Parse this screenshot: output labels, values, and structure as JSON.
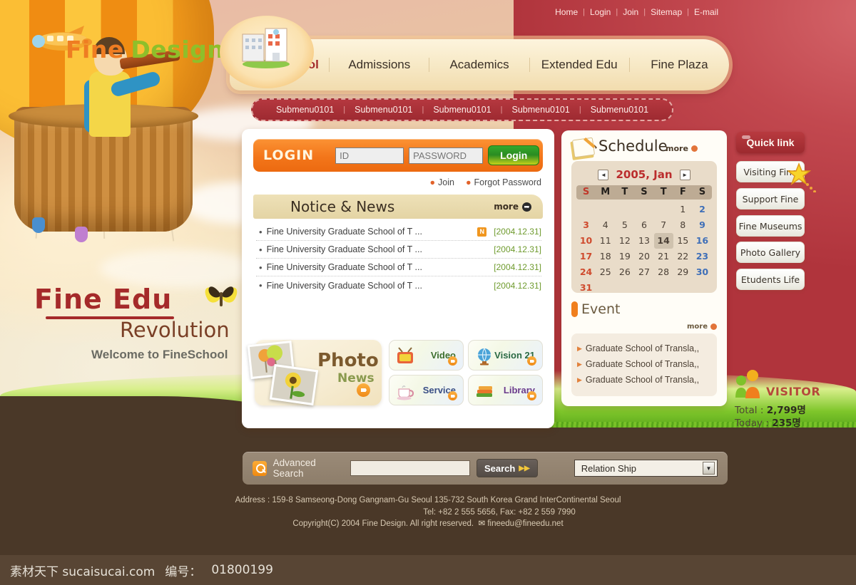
{
  "brand": {
    "name_part1": "Fine",
    "name_part2": "Design",
    "plane_icon": "airplane-icon"
  },
  "utility_nav": [
    {
      "label": "Home"
    },
    {
      "label": "Login"
    },
    {
      "label": "Join"
    },
    {
      "label": "Sitemap"
    },
    {
      "label": "E-mail"
    }
  ],
  "main_nav": [
    {
      "label": "About School",
      "active": true
    },
    {
      "label": "Admissions",
      "active": false
    },
    {
      "label": "Academics",
      "active": false
    },
    {
      "label": "Extended Edu",
      "active": false
    },
    {
      "label": "Fine Plaza",
      "active": false
    }
  ],
  "submenu": [
    {
      "label": "Submenu0101"
    },
    {
      "label": "Submenu0101"
    },
    {
      "label": "Submenu0101"
    },
    {
      "label": "Submenu0101"
    },
    {
      "label": "Submenu0101"
    }
  ],
  "login": {
    "title": "LOGIN",
    "id_placeholder": "ID",
    "id_value": "",
    "password_placeholder": "PASSWORD",
    "password_value": "",
    "button_label": "Login",
    "links": [
      {
        "label": "Join"
      },
      {
        "label": "Forgot Password"
      }
    ]
  },
  "notice": {
    "title": "Notice & News",
    "more_label": "more",
    "items": [
      {
        "text": "Fine University Graduate School of T ...",
        "date": "[2004.12.31]",
        "badge": "N"
      },
      {
        "text": "Fine University Graduate School of T ...",
        "date": "[2004.12.31]",
        "badge": ""
      },
      {
        "text": "Fine University Graduate School of T ...",
        "date": "[2004.12.31]",
        "badge": ""
      },
      {
        "text": "Fine University Graduate School of T ...",
        "date": "[2004.12.31]",
        "badge": ""
      }
    ]
  },
  "photo_news": {
    "line1": "Photo",
    "line2": "News"
  },
  "services": [
    {
      "label": "Video",
      "icon": "television-icon",
      "color": "#3c6e2e"
    },
    {
      "label": "Vision 21",
      "icon": "globe-icon",
      "color": "#2b6a44"
    },
    {
      "label": "Service",
      "icon": "coffee-cup-icon",
      "color": "#3a4f86"
    },
    {
      "label": "Library",
      "icon": "books-icon",
      "color": "#6a3a8c"
    }
  ],
  "schedule": {
    "title": "Schedule",
    "more_label": "more",
    "prev_label": "◄",
    "next_label": "►",
    "month_label": "2005, Jan",
    "dow": [
      "S",
      "M",
      "T",
      "S",
      "T",
      "F",
      "S"
    ],
    "lead_blanks": 5,
    "days": [
      1,
      2,
      3,
      4,
      5,
      6,
      7,
      8,
      9,
      10,
      11,
      12,
      13,
      14,
      15,
      16,
      17,
      18,
      19,
      20,
      21,
      22,
      23,
      24,
      25,
      26,
      27,
      28,
      29,
      30,
      31
    ],
    "today": 14
  },
  "event": {
    "title": "Event",
    "more_label": "more",
    "items": [
      {
        "text": "Graduate School of Transla,,"
      },
      {
        "text": "Graduate School of Transla,,"
      },
      {
        "text": "Graduate School of Transla,,"
      }
    ]
  },
  "quick_link": {
    "title": "Quick link",
    "items": [
      {
        "label": "Visiting Fine"
      },
      {
        "label": "Support Fine"
      },
      {
        "label": "Fine Museums"
      },
      {
        "label": "Photo Gallery"
      },
      {
        "label": "Etudents Life"
      }
    ]
  },
  "visitor": {
    "title": "VISITOR",
    "total_label": "Total",
    "total_value": "2,799명",
    "today_label": "Today",
    "today_value": "235명"
  },
  "search": {
    "label": "Advanced Search",
    "input_value": "",
    "input_placeholder": "",
    "button_label": "Search",
    "select_value": "Relation Ship"
  },
  "footer": {
    "address": "Address : 159-8 Samseong-Dong Gangnam-Gu Seoul 135-732 South Korea Grand InterContinental Seoul",
    "phone": "Tel: +82 2 555 5656, Fax: +82 2 559 7990",
    "copyright": "Copyright(C) 2004 Fine Design. All right reserved.",
    "email": "fineedu@fineedu.net"
  },
  "slogan": {
    "line1": "Fine Edu",
    "line2": "Revolution",
    "line3": "Welcome to FineSchool"
  },
  "watermark": {
    "site": "素材天下 sucaisucai.com",
    "id_label": "编号：",
    "id_value": "01800199"
  },
  "colors": {
    "header_red": "#b8343d",
    "accent_orange": "#ef8a18",
    "nav_cream": "#f7e9c6",
    "grass_green": "#7fc62b",
    "ground_brown": "#4a3828"
  }
}
